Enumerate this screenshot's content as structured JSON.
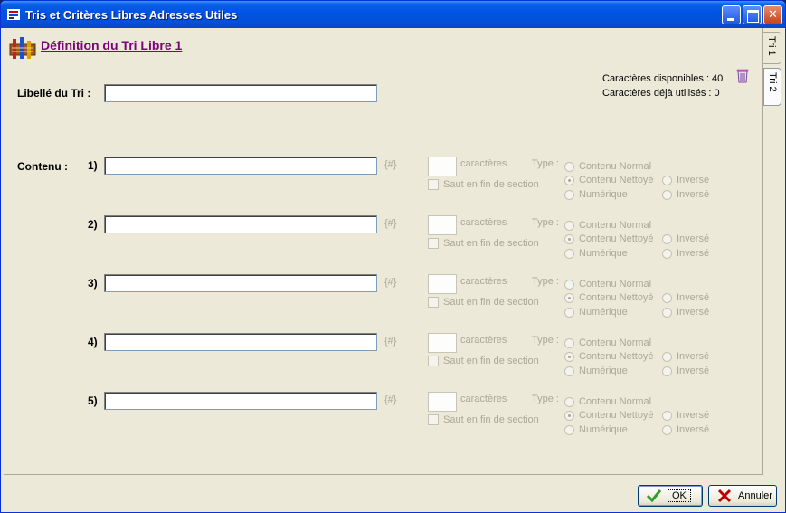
{
  "window": {
    "title": "Tris et Critères Libres Adresses Utiles",
    "controls": [
      "minimize",
      "maximize",
      "close"
    ]
  },
  "header": {
    "icon": "sort-tool-icon",
    "title": "Définition du Tri Libre 1"
  },
  "side_tabs": [
    {
      "label": "Tri 1",
      "selected": true
    },
    {
      "label": "Tri 2",
      "selected": false
    }
  ],
  "info": {
    "chars_available": "Caractères disponibles : 40",
    "chars_used": "Caractères déjà utilisés : 0"
  },
  "libelle": {
    "label": "Libellé du Tri :",
    "value": ""
  },
  "contenu_label": "Contenu :",
  "rows": [
    {
      "num": "1)",
      "value": "",
      "hash": "{#}",
      "chars": "",
      "caracteres": "caractères",
      "type_label": "Type :",
      "saut": "Saut en fin de section",
      "opt_normal": "Contenu Normal",
      "opt_nettoye": "Contenu Nettoyé",
      "opt_numerique": "Numérique",
      "opt_inverse1": "Inversé",
      "opt_inverse2": "Inversé"
    },
    {
      "num": "2)",
      "value": "",
      "hash": "{#}",
      "chars": "",
      "caracteres": "caractères",
      "type_label": "Type :",
      "saut": "Saut en fin de section",
      "opt_normal": "Contenu Normal",
      "opt_nettoye": "Contenu Nettoyé",
      "opt_numerique": "Numérique",
      "opt_inverse1": "Inversé",
      "opt_inverse2": "Inversé"
    },
    {
      "num": "3)",
      "value": "",
      "hash": "{#}",
      "chars": "",
      "caracteres": "caractères",
      "type_label": "Type :",
      "saut": "Saut en fin de section",
      "opt_normal": "Contenu Normal",
      "opt_nettoye": "Contenu Nettoyé",
      "opt_numerique": "Numérique",
      "opt_inverse1": "Inversé",
      "opt_inverse2": "Inversé"
    },
    {
      "num": "4)",
      "value": "",
      "hash": "{#}",
      "chars": "",
      "caracteres": "caractères",
      "type_label": "Type :",
      "saut": "Saut en fin de section",
      "opt_normal": "Contenu Normal",
      "opt_nettoye": "Contenu Nettoyé",
      "opt_numerique": "Numérique",
      "opt_inverse1": "Inversé",
      "opt_inverse2": "Inversé"
    },
    {
      "num": "5)",
      "value": "",
      "hash": "{#}",
      "chars": "",
      "caracteres": "caractères",
      "type_label": "Type :",
      "saut": "Saut en fin de section",
      "opt_normal": "Contenu Normal",
      "opt_nettoye": "Contenu Nettoyé",
      "opt_numerique": "Numérique",
      "opt_inverse1": "Inversé",
      "opt_inverse2": "Inversé"
    }
  ],
  "buttons": {
    "ok": "OK",
    "cancel": "Annuler"
  },
  "colors": {
    "title_link": "#800080",
    "disabled_text": "#aca899",
    "ok_check": "#2e9e2e",
    "cancel_x": "#c00000"
  }
}
